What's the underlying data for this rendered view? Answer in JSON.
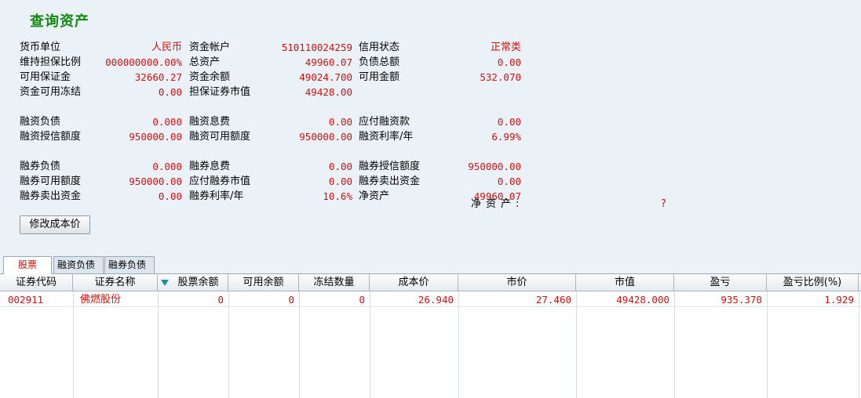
{
  "title": "查询资产",
  "summary": {
    "group1": [
      [
        {
          "label": "货币单位",
          "value": "人民币"
        },
        {
          "label": "资金帐户",
          "value": "510110024259"
        },
        {
          "label": "信用状态",
          "value": "正常类"
        }
      ],
      [
        {
          "label": "维持担保比例",
          "value": "000000000.00%"
        },
        {
          "label": "总资产",
          "value": "49960.07"
        },
        {
          "label": "负债总额",
          "value": "0.00"
        }
      ],
      [
        {
          "label": "可用保证金",
          "value": "32660.27"
        },
        {
          "label": "资金余额",
          "value": "49024.700"
        },
        {
          "label": "可用金额",
          "value": "532.070"
        }
      ],
      [
        {
          "label": "资金可用冻结",
          "value": "0.00"
        },
        {
          "label": "担保证券市值",
          "value": "49428.00"
        }
      ]
    ],
    "group2": [
      [
        {
          "label": "融资负债",
          "value": "0.000"
        },
        {
          "label": "融资息费",
          "value": "0.00"
        },
        {
          "label": "应付融资款",
          "value": "0.00"
        }
      ],
      [
        {
          "label": "融资授信额度",
          "value": "950000.00"
        },
        {
          "label": "融资可用额度",
          "value": "950000.00"
        },
        {
          "label": "融资利率/年",
          "value": "6.99%"
        }
      ]
    ],
    "group3": [
      [
        {
          "label": "融券负债",
          "value": "0.000"
        },
        {
          "label": "融券息费",
          "value": "0.00"
        },
        {
          "label": "融券授信额度",
          "value": "950000.00"
        }
      ],
      [
        {
          "label": "融券可用额度",
          "value": "950000.00"
        },
        {
          "label": "应付融券市值",
          "value": "0.00"
        },
        {
          "label": "融券卖出资金",
          "value": "0.00"
        }
      ],
      [
        {
          "label": "融券卖出资金",
          "value": "0.00"
        },
        {
          "label": "融券利率/年",
          "value": "10.6%"
        },
        {
          "label": "净资产",
          "value": "49960.07"
        }
      ]
    ]
  },
  "ghost": {
    "label": "净资产:",
    "value": "?"
  },
  "button": {
    "label": "修改成本价"
  },
  "tabs": [
    {
      "label": "股票",
      "active": true
    },
    {
      "label": "融资负债",
      "active": false
    },
    {
      "label": "融券负债",
      "active": false
    }
  ],
  "table": {
    "columns": [
      "证券代码",
      "证券名称",
      "股票余额",
      "可用余额",
      "冻结数量",
      "成本价",
      "市价",
      "市值",
      "盈亏",
      "盈亏比例(%)"
    ],
    "rows": [
      [
        "002911",
        "佛燃股份",
        "0",
        "0",
        "0",
        "26.940",
        "27.460",
        "49428.000",
        "935.370",
        "1.929"
      ]
    ]
  },
  "colors": {
    "accent_green": "#118811",
    "value_red": "#d01010",
    "sort_icon": "#1c8ea8",
    "background": "#eaf2f8"
  }
}
